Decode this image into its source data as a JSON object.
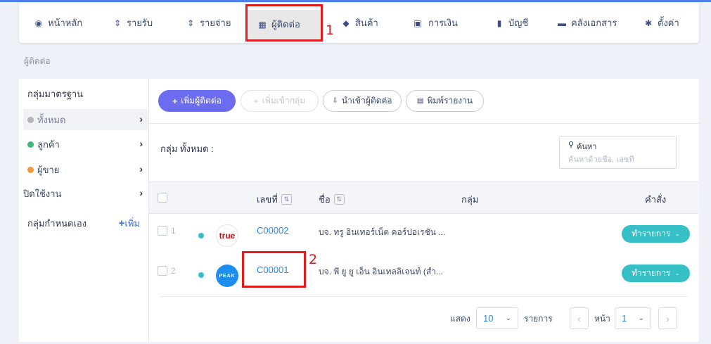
{
  "nav": {
    "items": [
      {
        "label": "หน้าหลัก",
        "icon": "chart-circle-icon"
      },
      {
        "label": "รายรับ",
        "icon": "income-list-icon"
      },
      {
        "label": "รายจ่าย",
        "icon": "expense-list-icon"
      },
      {
        "label": "ผู้ติดต่อ",
        "icon": "contacts-book-icon"
      },
      {
        "label": "สินค้า",
        "icon": "box-icon"
      },
      {
        "label": "การเงิน",
        "icon": "money-icon"
      },
      {
        "label": "บัญชี",
        "icon": "ledger-icon"
      },
      {
        "label": "คลังเอกสาร",
        "icon": "folder-icon"
      },
      {
        "label": "ตั้งค่า",
        "icon": "gear-icon"
      }
    ],
    "active_index": 3
  },
  "annotations": {
    "marker_1": "1",
    "marker_2": "2",
    "color": "#e01b1b"
  },
  "breadcrumb": "ผู้ติดต่อ",
  "sidebar": {
    "heading": "กลุ่มมาตรฐาน",
    "items": [
      {
        "label": "ทั้งหมด",
        "dot_color": "#b5b5b5"
      },
      {
        "label": "ลูกค้า",
        "dot_color": "#3cb878"
      },
      {
        "label": "ผู้ขาย",
        "dot_color": "#f0973c"
      },
      {
        "label": "ปิดใช้งาน"
      }
    ],
    "custom_heading": "กลุ่มกำหนดเอง",
    "add_label": "เพิ่ม"
  },
  "toolbar": {
    "add_contact": "เพิ่มผู้ติดต่อ",
    "add_to_group": "เพิ่มเข้ากลุ่ม",
    "import_contacts": "นำเข้าผู้ติดต่อ",
    "print_report": "พิมพ์รายงาน"
  },
  "group_label": "กลุ่ม ทั้งหมด :",
  "search": {
    "label": "ค้นหา",
    "placeholder": "ค้นหาด้วยชื่อ, เลขที่"
  },
  "table": {
    "headers": {
      "code": "เลขที่",
      "name": "ชื่อ",
      "group": "กลุ่ม",
      "action": "คำสั่ง"
    },
    "rows": [
      {
        "num": "1",
        "logo": "true",
        "code": "C00002",
        "name": "บจ. ทรู อินเทอร์เน็ต คอร์ปอเรชัน ...",
        "action": "ทำรายการ"
      },
      {
        "num": "2",
        "logo": "PEAK",
        "code": "C00001",
        "name": "บจ. พี ยู ยู เอ็น อินเทลลิเจนท์ (สำ...",
        "action": "ทำรายการ"
      }
    ]
  },
  "pager": {
    "show_label": "แสดง",
    "page_size": "10",
    "items_label": "รายการ",
    "page_label": "หน้า",
    "page": "1"
  },
  "colors": {
    "primary": "#6b6cf0",
    "teal": "#36bfc6",
    "link": "#2a8ad8"
  }
}
